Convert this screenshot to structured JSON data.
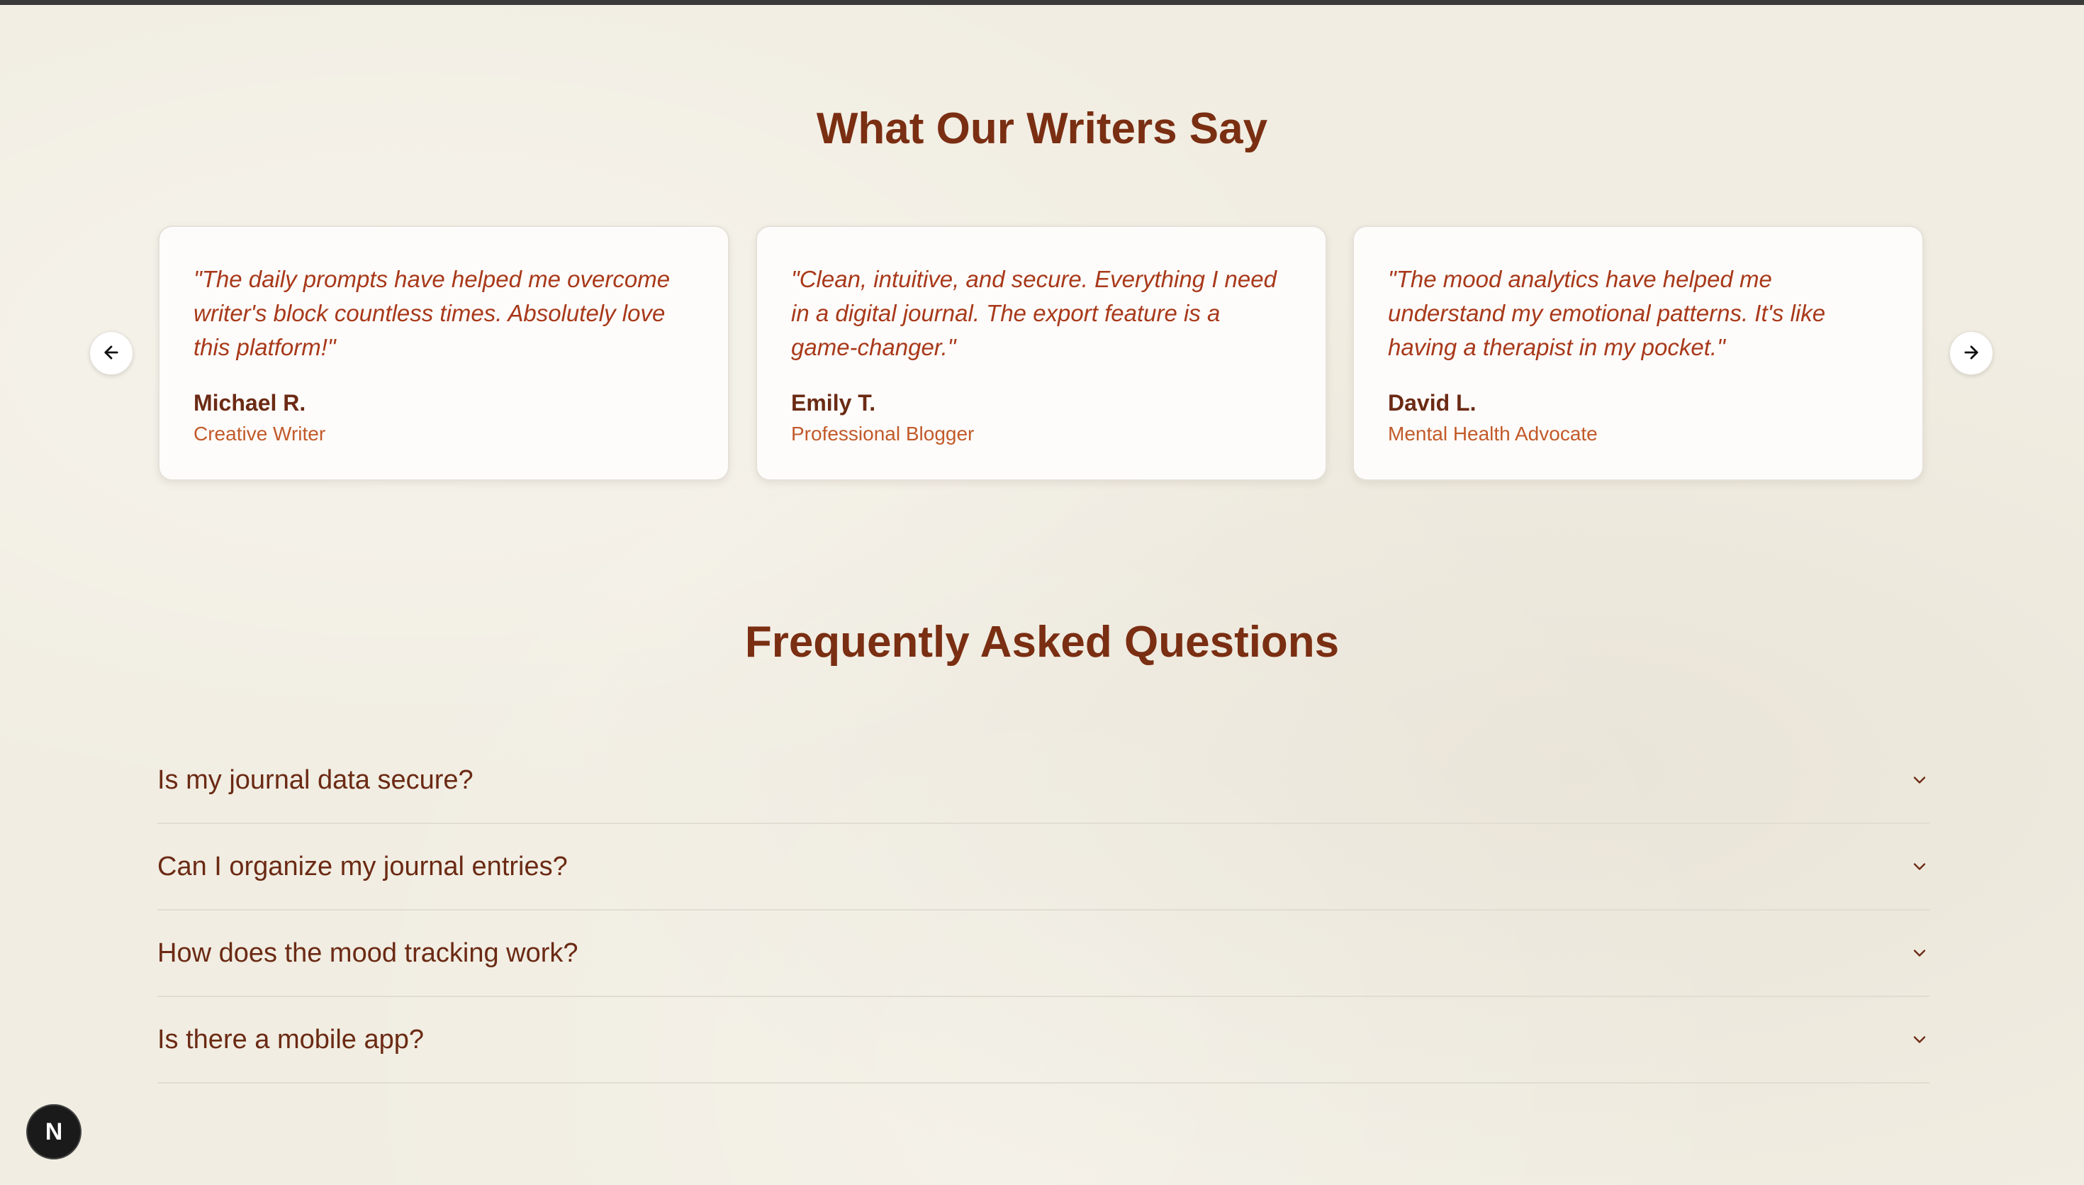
{
  "testimonials": {
    "title": "What Our Writers Say",
    "items": [
      {
        "quote": "\"The daily prompts have helped me overcome writer's block countless times. Absolutely love this platform!\"",
        "name": "Michael R.",
        "role": "Creative Writer"
      },
      {
        "quote": "\"Clean, intuitive, and secure. Everything I need in a digital journal. The export feature is a game-changer.\"",
        "name": "Emily T.",
        "role": "Professional Blogger"
      },
      {
        "quote": "\"The mood analytics have helped me understand my emotional patterns. It's like having a therapist in my pocket.\"",
        "name": "David L.",
        "role": "Mental Health Advocate"
      }
    ],
    "prev_icon": "arrow-left-icon",
    "next_icon": "arrow-right-icon"
  },
  "faq": {
    "title": "Frequently Asked Questions",
    "items": [
      {
        "question": "Is my journal data secure?"
      },
      {
        "question": "Can I organize my journal entries?"
      },
      {
        "question": "How does the mood tracking work?"
      },
      {
        "question": "Is there a mobile app?"
      }
    ],
    "toggle_icon": "chevron-down-icon"
  },
  "dev_badge": {
    "label": "N",
    "icon": "nextjs-logo-icon"
  },
  "colors": {
    "heading": "#7a2e12",
    "quote": "#a8391a",
    "role": "#c25a2a",
    "background": "#f1ede2",
    "card": "#fdfcfa"
  }
}
